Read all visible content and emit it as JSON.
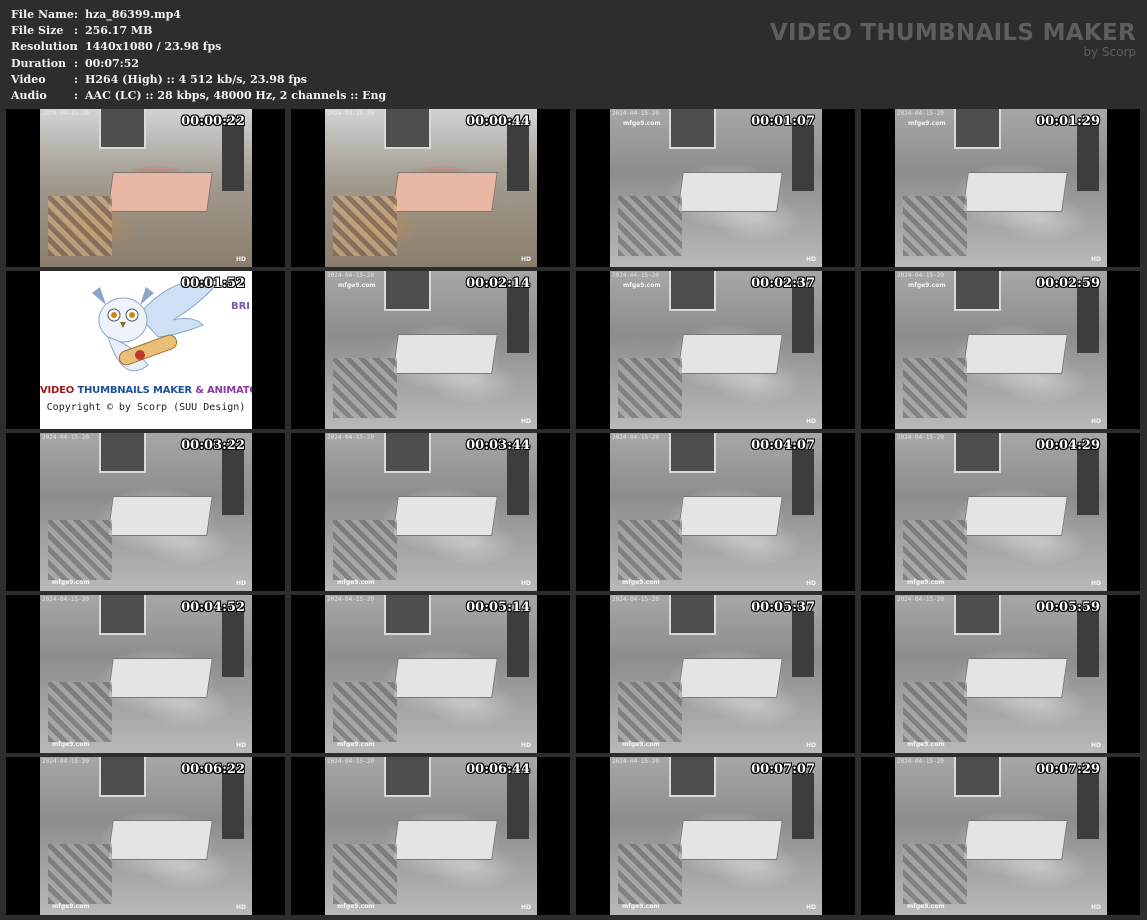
{
  "info": [
    {
      "label": "File Name",
      "value": "hza_86399.mp4"
    },
    {
      "label": "File Size",
      "value": "256.17 MB"
    },
    {
      "label": "Resolution",
      "value": "1440x1080 / 23.98 fps"
    },
    {
      "label": "Duration",
      "value": "00:07:52"
    },
    {
      "label": "Video",
      "value": "H264 (High) :: 4 512 kb/s, 23.98 fps"
    },
    {
      "label": "Audio",
      "value": "AAC (LC) :: 28 kbps, 48000 Hz, 2 channels :: Eng"
    }
  ],
  "separator": ":",
  "brand": {
    "title": "VIDEO THUMBNAILS MAKER",
    "subtitle": "by Scorp",
    "color": "#5e5e5e"
  },
  "thumbnails": [
    {
      "time": "00:00:22",
      "kind": "color"
    },
    {
      "time": "00:00:44",
      "kind": "color"
    },
    {
      "time": "00:01:07",
      "kind": "night"
    },
    {
      "time": "00:01:29",
      "kind": "night"
    },
    {
      "time": "00:01:52",
      "kind": "promo"
    },
    {
      "time": "00:02:14",
      "kind": "night"
    },
    {
      "time": "00:02:37",
      "kind": "night"
    },
    {
      "time": "00:02:59",
      "kind": "night"
    },
    {
      "time": "00:03:22",
      "kind": "night"
    },
    {
      "time": "00:03:44",
      "kind": "night"
    },
    {
      "time": "00:04:07",
      "kind": "night"
    },
    {
      "time": "00:04:29",
      "kind": "night"
    },
    {
      "time": "00:04:52",
      "kind": "night"
    },
    {
      "time": "00:05:14",
      "kind": "night"
    },
    {
      "time": "00:05:37",
      "kind": "night"
    },
    {
      "time": "00:05:59",
      "kind": "night"
    },
    {
      "time": "00:06:22",
      "kind": "night"
    },
    {
      "time": "00:06:44",
      "kind": "night"
    },
    {
      "time": "00:07:07",
      "kind": "night"
    },
    {
      "time": "00:07:29",
      "kind": "night"
    }
  ],
  "frame_marks": {
    "site": "mfge9.com",
    "hd": "HD",
    "date": "2024-04-15-20"
  },
  "promo": {
    "title_part1": "VIDEO ",
    "title_part2": "THUMBNAILS MAKER",
    "title_part3": " & ANIMATO",
    "copyright": "Copyright © by Scorp (SUU Design)",
    "side_text": "BRI",
    "owl_icon": "owl-with-scroll-icon"
  },
  "colors": {
    "background": "#2d2d2d",
    "cell": "#000000",
    "info_text": "#f2f2f2"
  }
}
